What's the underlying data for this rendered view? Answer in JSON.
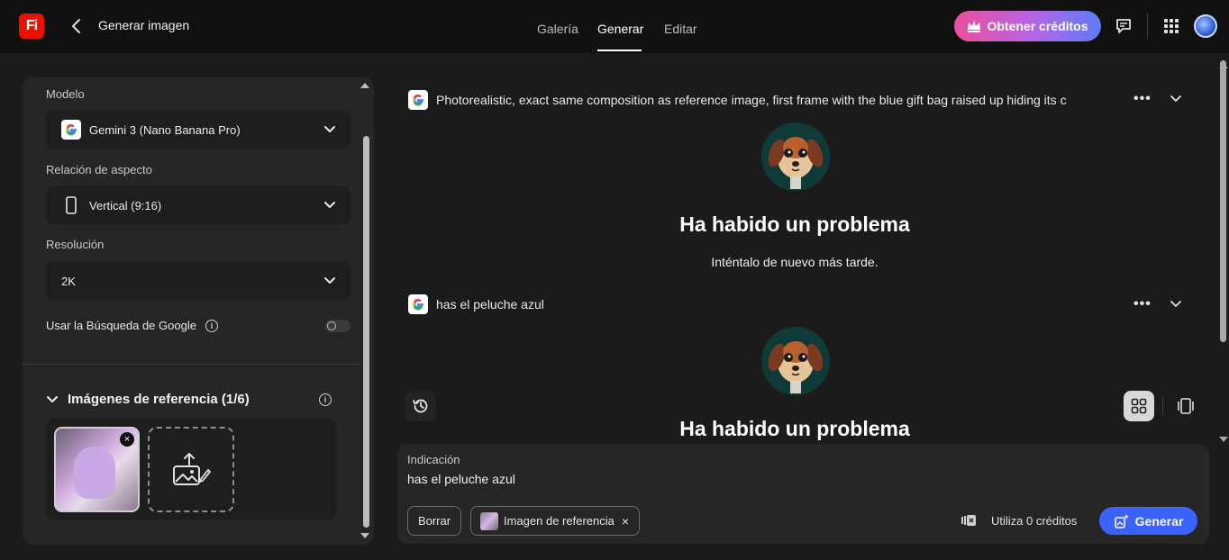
{
  "header": {
    "logo_text": "Fi",
    "title": "Generar imagen",
    "nav": [
      {
        "label": "Galería",
        "active": false
      },
      {
        "label": "Generar",
        "active": true
      },
      {
        "label": "Editar",
        "active": false
      }
    ],
    "credits_button": "Obtener créditos"
  },
  "left_panel": {
    "model_label": "Modelo",
    "model_value": "Gemini 3 (Nano Banana Pro)",
    "aspect_label": "Relación de aspecto",
    "aspect_value": "Vertical (9:16)",
    "resolution_label": "Resolución",
    "resolution_value": "2K",
    "google_search_label": "Usar la Búsqueda de Google",
    "google_search_enabled": false,
    "reference_title": "Imágenes de referencia (1/6)"
  },
  "messages": [
    {
      "prompt": "Photorealistic, exact same composition as reference image, first frame with the blue gift bag raised up hiding its c",
      "error_title": "Ha habido un problema",
      "error_sub": "Inténtalo de nuevo más tarde."
    },
    {
      "prompt": "has el peluche azul",
      "error_title": "Ha habido un problema"
    }
  ],
  "prompt_box": {
    "label": "Indicación",
    "text": "has el peluche azul",
    "clear_button": "Borrar",
    "reference_chip": "Imagen de referencia",
    "credits_text": "Utiliza 0 créditos",
    "generate_button": "Generar"
  },
  "colors": {
    "accent_blue": "#3b63fb",
    "logo_red": "#eb1000",
    "background": "#1b1b1b",
    "panel": "#262626"
  }
}
